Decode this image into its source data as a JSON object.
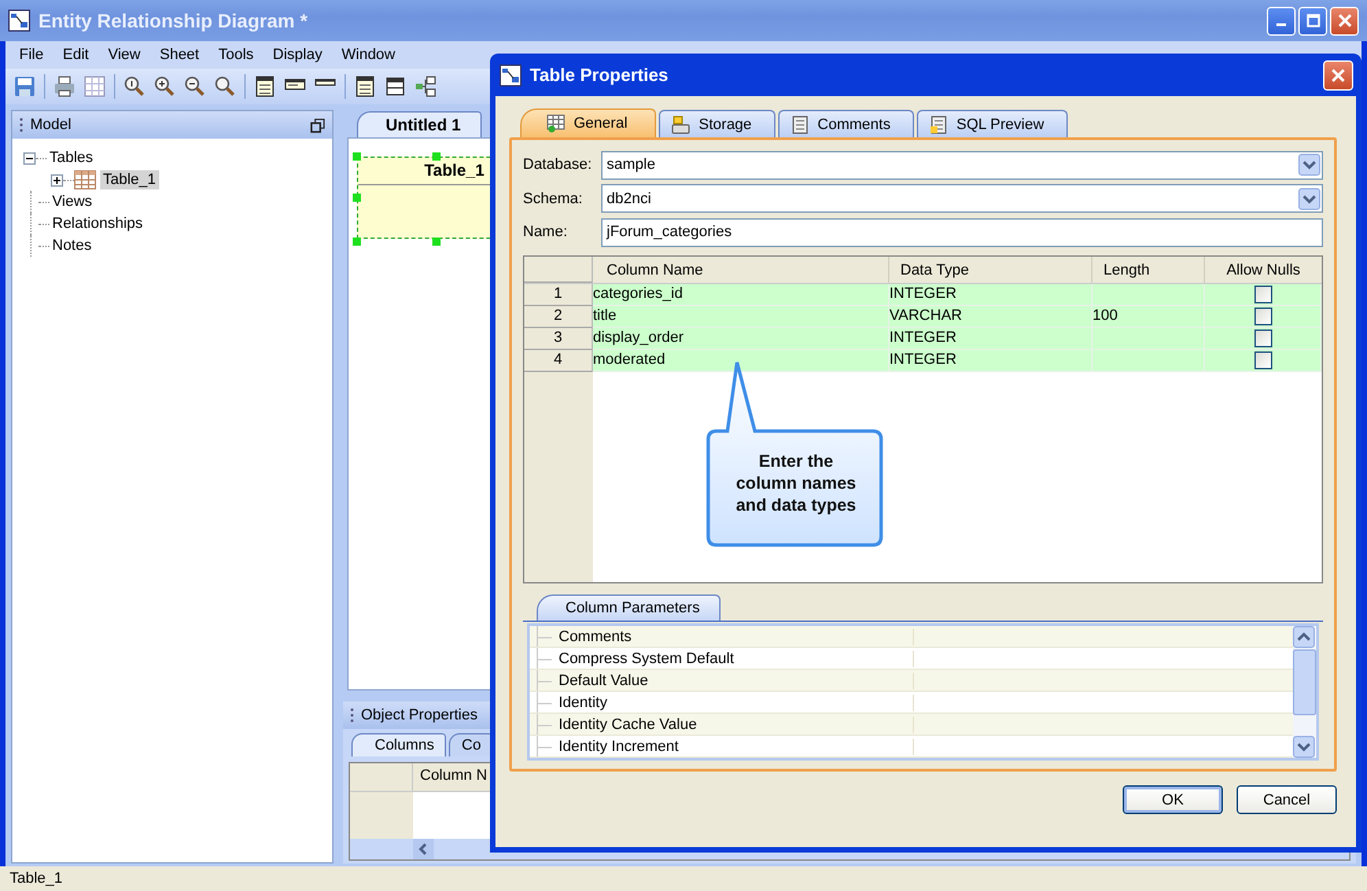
{
  "window": {
    "title": "Entity Relationship Diagram *"
  },
  "menu": [
    "File",
    "Edit",
    "View",
    "Sheet",
    "Tools",
    "Display",
    "Window"
  ],
  "model_panel": {
    "title": "Model",
    "tree": [
      {
        "label": "Tables",
        "expanded": true,
        "selected": false,
        "children": [
          {
            "label": "Table_1",
            "expanded": false,
            "selected": true
          }
        ]
      },
      {
        "label": "Views"
      },
      {
        "label": "Relationships"
      },
      {
        "label": "Notes"
      }
    ]
  },
  "document_tabs": [
    {
      "label": "Untitled 1",
      "selected": true
    }
  ],
  "canvas": {
    "entities": [
      {
        "title": "Table_1",
        "selected": true
      }
    ]
  },
  "object_properties": {
    "title": "Object Properties",
    "tabs": [
      {
        "label": "Columns",
        "selected": true
      },
      {
        "label": "Co",
        "selected": false
      }
    ],
    "columns": [
      "Column N"
    ]
  },
  "status_bar": "Table_1",
  "dialog": {
    "title": "Table Properties",
    "tabs": [
      {
        "label": "General",
        "selected": true
      },
      {
        "label": "Storage",
        "selected": false
      },
      {
        "label": "Comments",
        "selected": false
      },
      {
        "label": "SQL Preview",
        "selected": false
      }
    ],
    "fields": [
      {
        "label": "Database:",
        "value": "sample",
        "kind": "dropdown"
      },
      {
        "label": "Schema:",
        "value": "db2nci",
        "kind": "dropdown"
      },
      {
        "label": "Name:",
        "value": "jForum_categories",
        "kind": "text"
      }
    ],
    "grid": {
      "columns": [
        "Column Name",
        "Data Type",
        "Length",
        "Allow Nulls"
      ],
      "rows": [
        {
          "number": "1",
          "name": "categories_id",
          "type": "INTEGER",
          "length": "",
          "allow_nulls": false
        },
        {
          "number": "2",
          "name": "title",
          "type": "VARCHAR",
          "length": "100",
          "allow_nulls": false
        },
        {
          "number": "3",
          "name": "display_order",
          "type": "INTEGER",
          "length": "",
          "allow_nulls": false
        },
        {
          "number": "4",
          "name": "moderated",
          "type": "INTEGER",
          "length": "",
          "allow_nulls": false
        }
      ]
    },
    "callout": "Enter the column names and data types",
    "parameters": {
      "tab": "Column Parameters",
      "rows": [
        "Comments",
        "Compress System Default",
        "Default Value",
        "Identity",
        "Identity Cache Value",
        "Identity Increment"
      ]
    },
    "buttons": [
      "OK",
      "Cancel"
    ]
  }
}
